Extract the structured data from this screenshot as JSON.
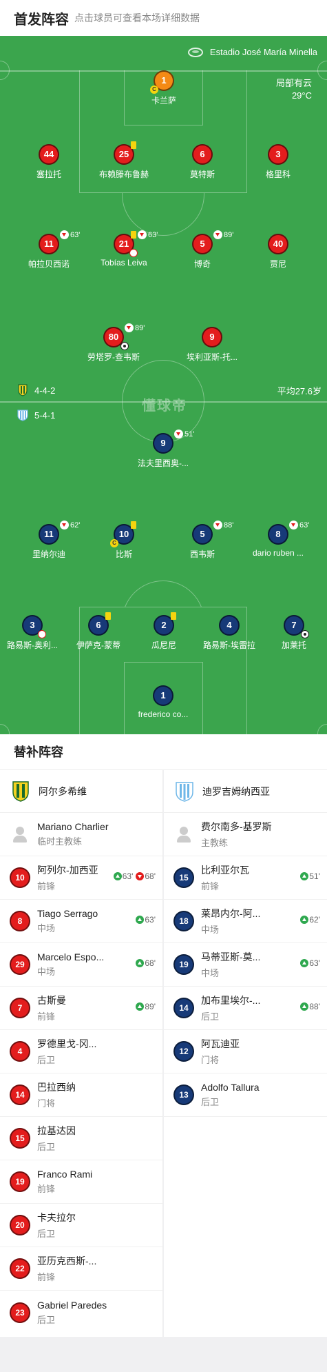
{
  "header": {
    "title": "首发阵容",
    "subtitle": "点击球员可查看本场详细数据"
  },
  "pitch": {
    "stadium": "Estadio José María Minella",
    "weather": "局部有云",
    "temperature": "29°C",
    "home_formation": "4-4-2",
    "away_formation": "5-4-1",
    "avg_age": "平均27.6岁",
    "watermark": "懂球帝"
  },
  "home_lineup": [
    {
      "num": "1",
      "name": "卡兰萨",
      "captain": true
    },
    {
      "num": "44",
      "name": "塞拉托"
    },
    {
      "num": "25",
      "name": "布赖滕布鲁赫",
      "yellow": true
    },
    {
      "num": "6",
      "name": "莫特斯"
    },
    {
      "num": "3",
      "name": "格里科"
    },
    {
      "num": "11",
      "name": "帕拉贝西诺",
      "sub_min": "63'"
    },
    {
      "num": "21",
      "name": "Tobías Leiva",
      "yellow": true,
      "sub_min": "63'"
    },
    {
      "num": "5",
      "name": "博奇",
      "sub_min": "89'"
    },
    {
      "num": "40",
      "name": "贾尼"
    },
    {
      "num": "80",
      "name": "劳塔罗-查韦斯",
      "sub_min": "89'"
    },
    {
      "num": "9",
      "name": "埃利亚斯-托..."
    }
  ],
  "away_lineup": [
    {
      "num": "9",
      "name": "法夫里西奥-...",
      "sub_min": "51'"
    },
    {
      "num": "11",
      "name": "里纳尔迪",
      "sub_min": "62'"
    },
    {
      "num": "10",
      "name": "比斯",
      "yellow": true,
      "captain": true
    },
    {
      "num": "5",
      "name": "西韦斯",
      "sub_min": "88'"
    },
    {
      "num": "8",
      "name": "dario ruben ...",
      "sub_min": "63'"
    },
    {
      "num": "3",
      "name": "路易斯-奥利..."
    },
    {
      "num": "6",
      "name": "伊萨克-蒙蒂",
      "yellow": true
    },
    {
      "num": "2",
      "name": "瓜尼尼",
      "yellow": true
    },
    {
      "num": "4",
      "name": "路易斯-埃雷拉"
    },
    {
      "num": "7",
      "name": "加莱托"
    },
    {
      "num": "1",
      "name": "frederico co..."
    }
  ],
  "icons": {
    "captain": "C"
  },
  "subs": {
    "title": "替补阵容",
    "home_team": "阿尔多希维",
    "away_team": "迪罗吉姆纳西亚",
    "home": [
      {
        "num": "",
        "name": "Mariano Charlier",
        "pos": "临时主教练",
        "coach": true
      },
      {
        "num": "10",
        "name": "阿列尔-加西亚",
        "pos": "前锋",
        "in": "63'",
        "out": "68'"
      },
      {
        "num": "8",
        "name": "Tiago Serrago",
        "pos": "中场",
        "in": "63'"
      },
      {
        "num": "29",
        "name": "Marcelo Espo...",
        "pos": "中场",
        "in": "68'"
      },
      {
        "num": "7",
        "name": "古斯曼",
        "pos": "前锋",
        "in": "89'"
      },
      {
        "num": "4",
        "name": "罗德里戈-冈...",
        "pos": "后卫"
      },
      {
        "num": "14",
        "name": "巴拉西纳",
        "pos": "门将"
      },
      {
        "num": "15",
        "name": "拉基达因",
        "pos": "后卫"
      },
      {
        "num": "19",
        "name": "Franco Rami",
        "pos": "前锋"
      },
      {
        "num": "20",
        "name": "卡夫拉尔",
        "pos": "后卫"
      },
      {
        "num": "22",
        "name": "亚历克西斯-...",
        "pos": "前锋"
      },
      {
        "num": "23",
        "name": "Gabriel Paredes",
        "pos": "后卫"
      }
    ],
    "away": [
      {
        "num": "",
        "name": "费尔南多-基罗斯",
        "pos": "主教练",
        "coach": true
      },
      {
        "num": "15",
        "name": "比利亚尔瓦",
        "pos": "前锋",
        "in": "51'"
      },
      {
        "num": "18",
        "name": "莱昂内尔-阿...",
        "pos": "中场",
        "in": "62'"
      },
      {
        "num": "19",
        "name": "马蒂亚斯-莫...",
        "pos": "中场",
        "in": "63'"
      },
      {
        "num": "14",
        "name": "加布里埃尔-...",
        "pos": "后卫",
        "in": "88'"
      },
      {
        "num": "12",
        "name": "阿瓦迪亚",
        "pos": "门将"
      },
      {
        "num": "13",
        "name": "Adolfo Tallura",
        "pos": "后卫"
      }
    ]
  }
}
